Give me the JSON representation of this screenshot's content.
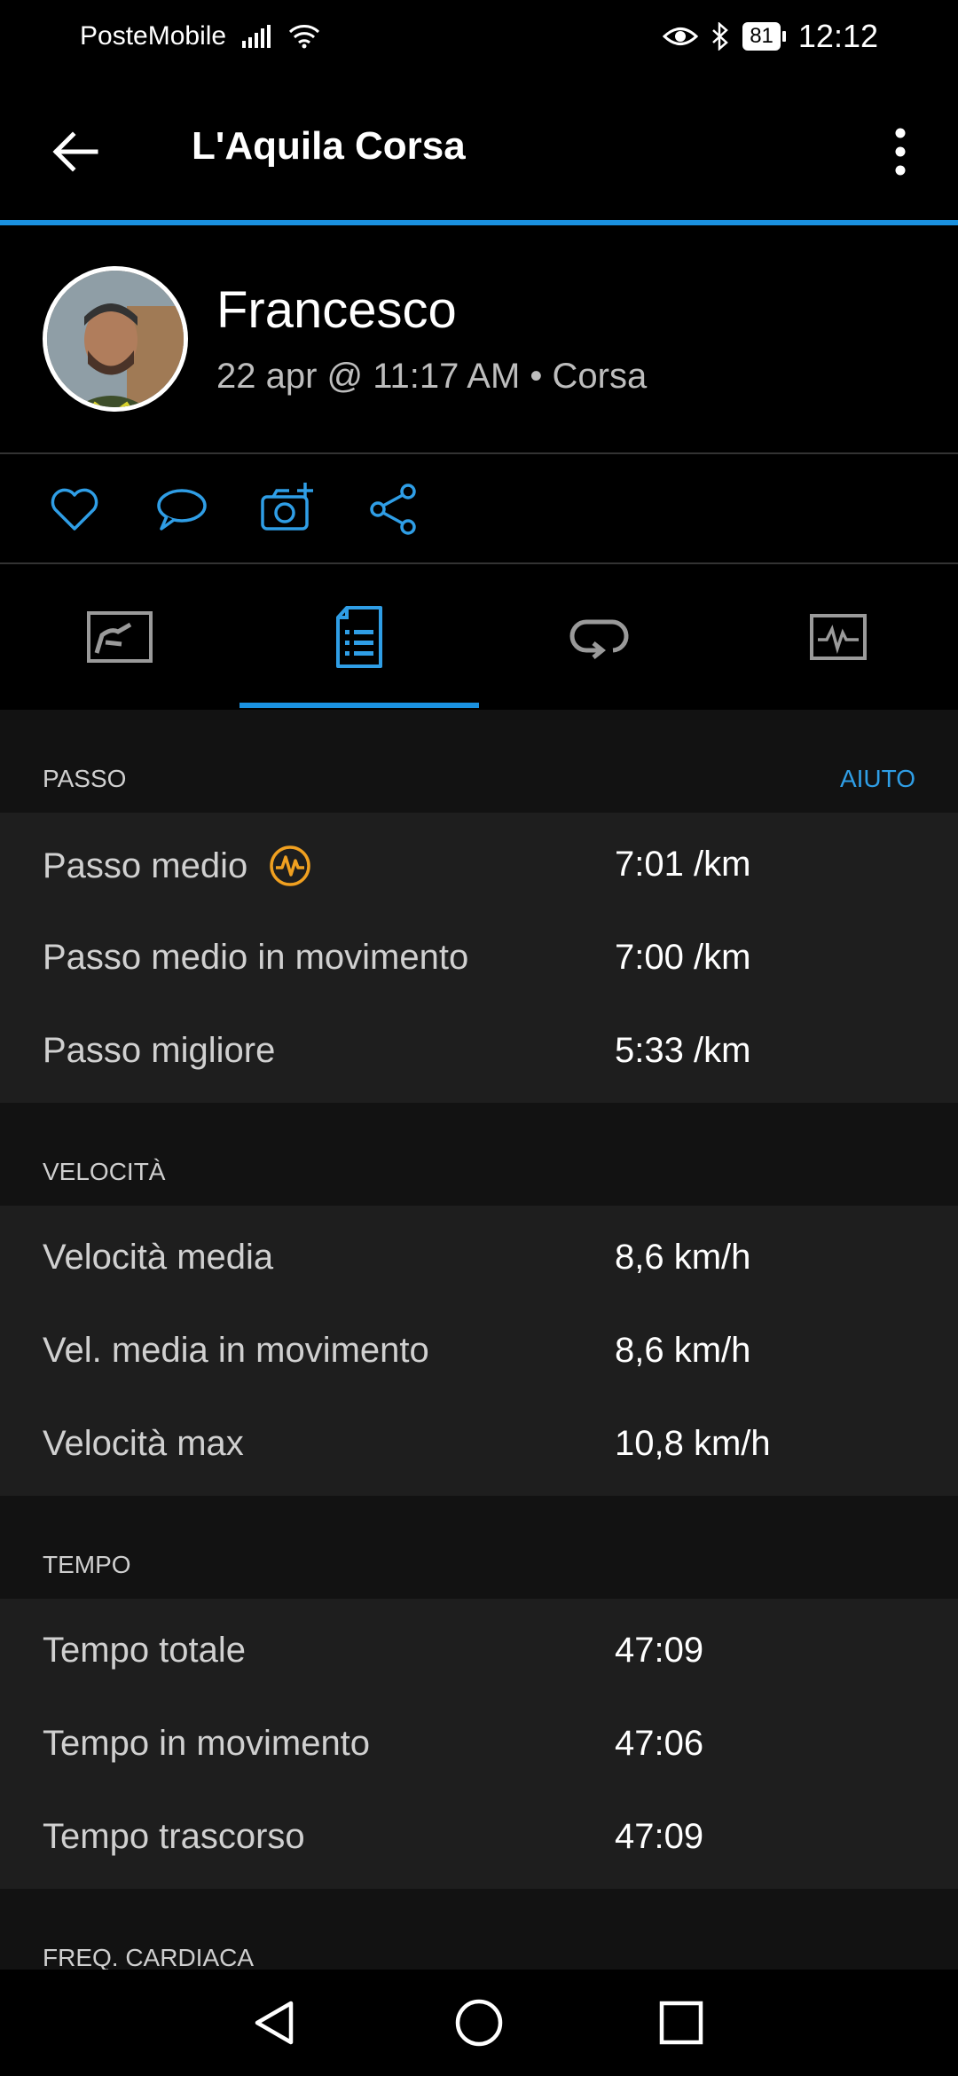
{
  "status_bar": {
    "carrier": "PosteMobile",
    "battery": "81",
    "time": "12:12"
  },
  "app_bar": {
    "title": "L'Aquila Corsa"
  },
  "activity": {
    "user_name": "Francesco",
    "subtitle": "22 apr @ 11:17 AM • Corsa"
  },
  "accent_color": "#1a91e0",
  "sections": [
    {
      "label": "PASSO",
      "help": "AIUTO",
      "rows": [
        {
          "key": "Passo medio",
          "value": "7:01 /km"
        },
        {
          "key": "Passo medio in movimento",
          "value": "7:00 /km"
        },
        {
          "key": "Passo migliore",
          "value": "5:33 /km"
        }
      ]
    },
    {
      "label": "VELOCITÀ",
      "rows": [
        {
          "key": "Velocità media",
          "value": "8,6 km/h"
        },
        {
          "key": "Vel. media in movimento",
          "value": "8,6 km/h"
        },
        {
          "key": "Velocità max",
          "value": "10,8 km/h"
        }
      ]
    },
    {
      "label": "TEMPO",
      "rows": [
        {
          "key": "Tempo totale",
          "value": "47:09"
        },
        {
          "key": "Tempo in movimento",
          "value": "47:06"
        },
        {
          "key": "Tempo trascorso",
          "value": "47:09"
        }
      ]
    },
    {
      "label": "FREQ. CARDIACA"
    }
  ]
}
